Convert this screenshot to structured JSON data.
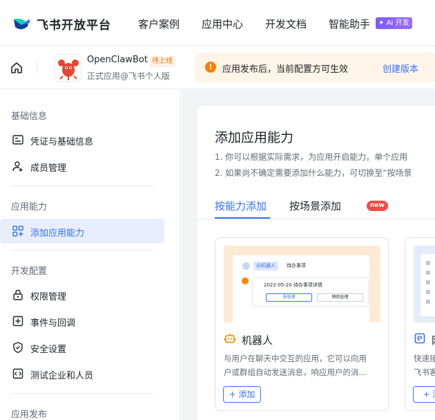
{
  "topnav": {
    "brand": "飞书开放平台",
    "links": [
      "客户案例",
      "应用中心",
      "开发文档",
      "智能助手"
    ],
    "ai_badge": "AI 开发"
  },
  "appbar": {
    "app_name": "OpenClawBot",
    "app_status": "待上线",
    "app_subtitle": "正式应用@飞书个人版",
    "notice_icon": "!",
    "notice_text": "应用发布后，当前配置方可生效",
    "notice_link": "创建版本"
  },
  "sidebar": {
    "sections": [
      {
        "title": "基础信息",
        "items": [
          "凭证与基础信息",
          "成员管理"
        ]
      },
      {
        "title": "应用能力",
        "items": [
          "添加应用能力"
        ]
      },
      {
        "title": "开发配置",
        "items": [
          "权限管理",
          "事件与回调",
          "安全设置",
          "测试企业和人员"
        ]
      },
      {
        "title": "应用发布",
        "items": []
      }
    ],
    "active_item": "添加应用能力"
  },
  "main": {
    "title": "添加应用能力",
    "tips": [
      "1. 你可以根据实际需求，为应用开启能力。单个应用",
      "2. 如果尚不确定需要添加什么能力，可切换至“按场景"
    ],
    "tabs": [
      "按能力添加",
      "按场景添加"
    ],
    "active_tab": "按能力添加",
    "new_badge": "new",
    "cards": [
      {
        "name": "机器人",
        "desc_lines": [
          "与用户在聊天中交互的应用，它可以向用",
          "户或群组自动发送消息，响应用户的消..."
        ],
        "add_label": "+ 添加",
        "mock": {
          "chip": "@机器人",
          "chip_text": "待办事项",
          "box_text": "2022-05-20 待办事项详情",
          "btn_primary": "去处理",
          "btn_secondary": "稍后处理"
        }
      },
      {
        "name": "网",
        "desc_lines": [
          "快速接",
          "飞书客"
        ],
        "add_label": "+ 添"
      }
    ]
  },
  "colors": {
    "accent": "#3370ff",
    "notice_bg": "#fef4e8",
    "active_bg": "#e8eefe",
    "status": "#de7802"
  }
}
